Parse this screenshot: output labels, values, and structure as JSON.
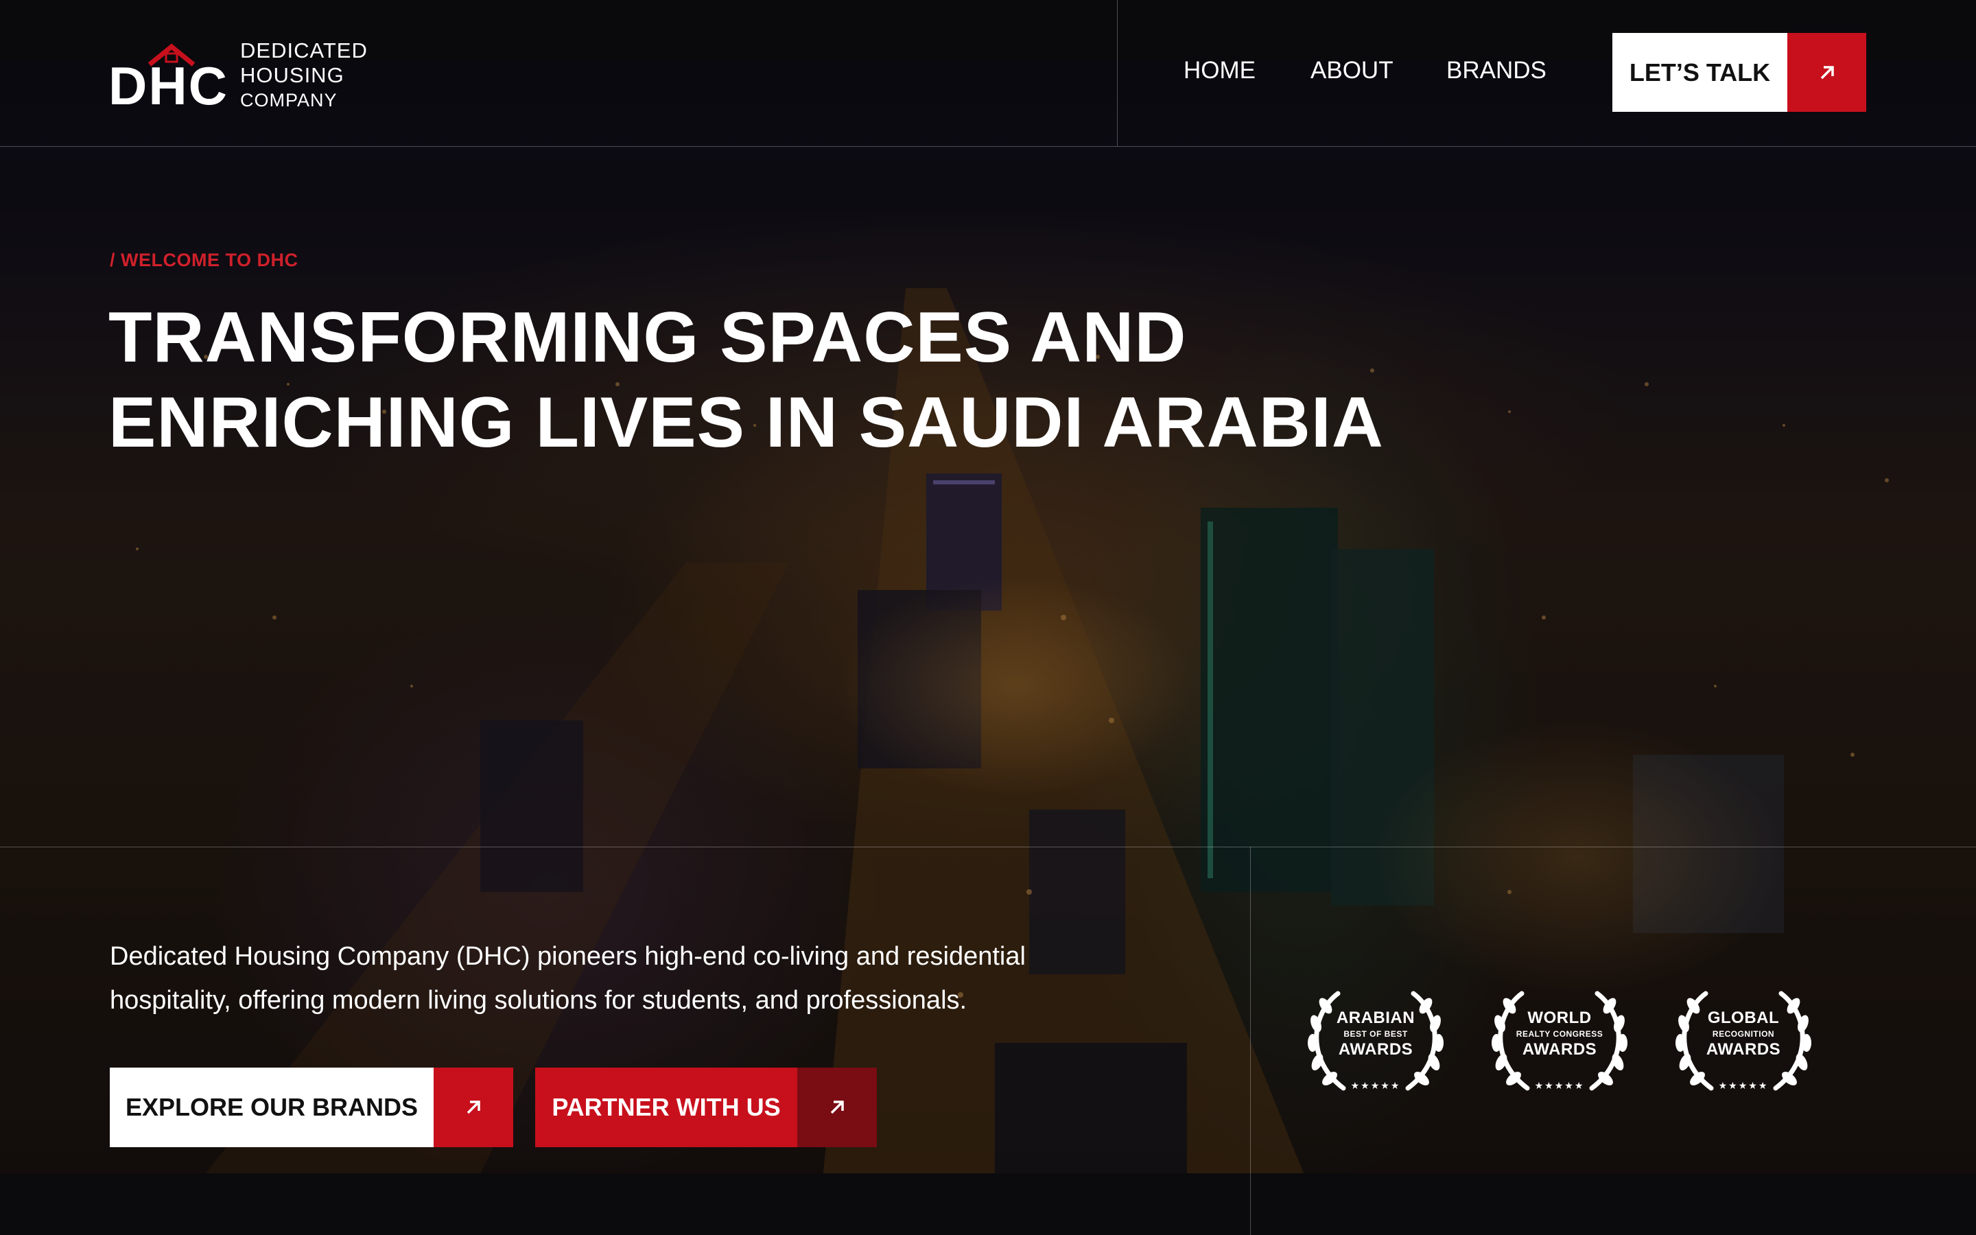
{
  "brand": {
    "logo_letters": "DHC",
    "name_line1": "DEDICATED",
    "name_line2": "HOUSING",
    "name_line3": "COMPANY",
    "accent_color": "#c8101d"
  },
  "nav": {
    "items": [
      {
        "label": "HOME"
      },
      {
        "label": "ABOUT"
      },
      {
        "label": "BRANDS"
      }
    ],
    "cta_label": "LET’S TALK",
    "cta_icon": "arrow-up-right-icon"
  },
  "hero": {
    "eyebrow": "/ WELCOME TO DHC",
    "headline_line1": "TRANSFORMING SPACES AND",
    "headline_line2": "ENRICHING LIVES IN SAUDI ARABIA",
    "description_line1": "Dedicated Housing Company (DHC) pioneers high-end co-living and residential",
    "description_line2": "hospitality, offering modern living solutions for students, and professionals.",
    "primary_button": "EXPLORE OUR BRANDS",
    "secondary_button": "PARTNER WITH US",
    "button_icon": "arrow-up-right-icon"
  },
  "awards": [
    {
      "line1": "ARABIAN",
      "line2": "BEST OF BEST",
      "line3": "AWARDS",
      "stars": "★★★★★"
    },
    {
      "line1": "WORLD",
      "line2": "REALTY CONGRESS",
      "line3": "AWARDS",
      "stars": "★★★★★"
    },
    {
      "line1": "GLOBAL",
      "line2": "RECOGNITION",
      "line3": "AWARDS",
      "stars": "★★★★★"
    }
  ]
}
